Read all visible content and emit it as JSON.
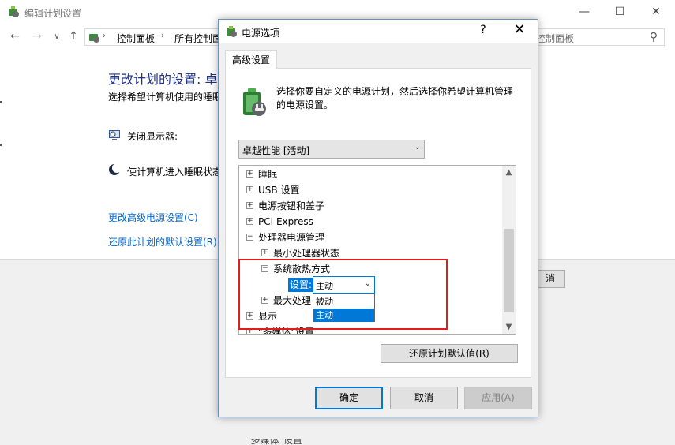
{
  "background_window": {
    "title": "编辑计划设置",
    "controls": {
      "minimize": "—",
      "maximize": "☐",
      "close": "✕"
    },
    "nav": {
      "back": "←",
      "forward": "→",
      "dropdown": "∨",
      "up": "↑"
    },
    "breadcrumb": [
      "控制面板",
      "所有控制面"
    ],
    "breadcrumb_sep": "›",
    "search_placeholder": "控制面板",
    "heading": "更改计划的设置: 卓",
    "subtitle": "选择希望计算机使用的睡眠",
    "rows": [
      {
        "label": "关闭显示器:",
        "icon": "monitor-icon"
      },
      {
        "label": "使计算机进入睡眠状态",
        "icon": "moon-icon"
      }
    ],
    "links": {
      "advanced": "更改高级电源设置(C)",
      "restore": "还原此计划的默认设置(R)"
    },
    "cancel_fragment": "消"
  },
  "dialog": {
    "title": "电源选项",
    "help": "?",
    "close": "✕",
    "tab": "高级设置",
    "description": "选择你要自定义的电源计划，然后选择你希望计算机管理的电源设置。",
    "plan_select": {
      "value": "卓越性能 [活动]"
    },
    "tree_items": [
      {
        "label": "睡眠",
        "expander": "+",
        "level": 0
      },
      {
        "label": "USB 设置",
        "expander": "+",
        "level": 0
      },
      {
        "label": "电源按钮和盖子",
        "expander": "+",
        "level": 0
      },
      {
        "label": "PCI Express",
        "expander": "+",
        "level": 0
      },
      {
        "label": "处理器电源管理",
        "expander": "−",
        "level": 0
      },
      {
        "label": "最小处理器状态",
        "expander": "+",
        "level": 1
      },
      {
        "label": "系统散热方式",
        "expander": "−",
        "level": 1
      },
      {
        "label": "最大处理",
        "expander": "+",
        "level": 1
      },
      {
        "label": "显示",
        "expander": "+",
        "level": 0
      },
      {
        "label": "\"多媒体\"设置",
        "expander": "+",
        "level": 0
      }
    ],
    "setting": {
      "label": "设置:",
      "value": "主动",
      "options": [
        "被动",
        "主动"
      ],
      "selected_index": 1
    },
    "restore_button": "还原计划默认值(R)",
    "buttons": {
      "ok": "确定",
      "cancel": "取消",
      "apply": "应用(A)"
    }
  },
  "colors": {
    "highlight_border": "#e31b1b",
    "selection": "#0078d7",
    "link": "#0066cc",
    "heading": "#1e3287"
  },
  "bottom_fragment": "\"多媒体\"设置"
}
